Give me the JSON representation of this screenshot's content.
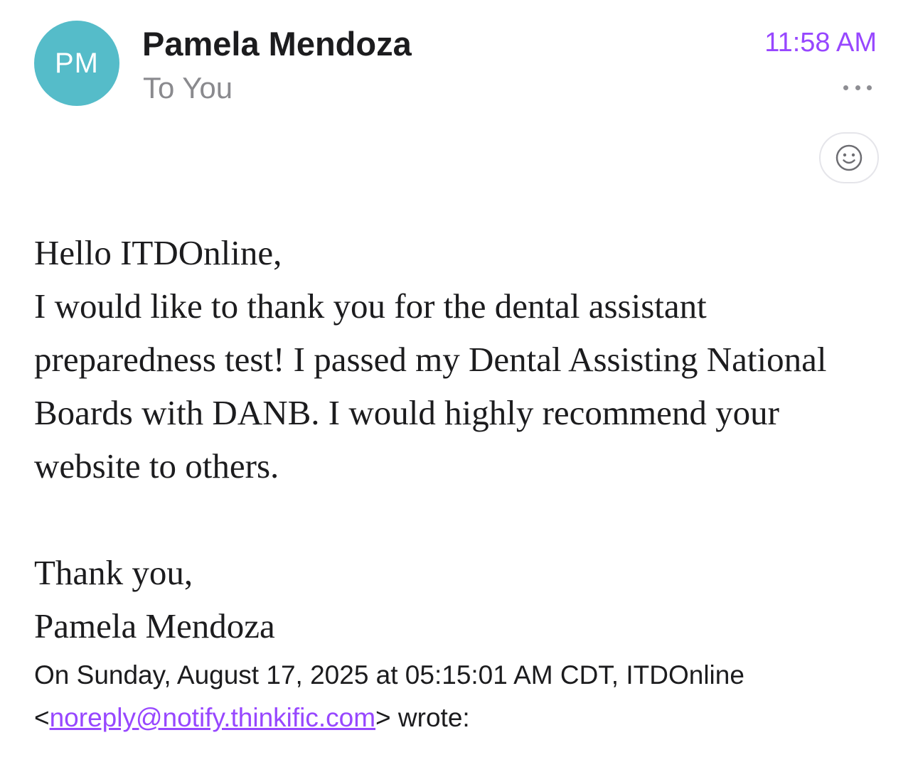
{
  "colors": {
    "accent": "#9747ff",
    "avatar_bg": "#55bcc9"
  },
  "header": {
    "avatar_initials": "PM",
    "sender_name": "Pamela Mendoza",
    "recipient": "To You",
    "time": "11:58 AM",
    "more_icon": "ellipsis-icon",
    "reaction_icon": "smiley-icon"
  },
  "message": {
    "greeting": "Hello ITDOnline,",
    "paragraph": "I would like to thank you for the dental assistant preparedness test! I passed my Dental Assisting National Boards with DANB. I would highly recommend your website to others.",
    "closing": "Thank you,",
    "signature": "Pamela Mendoza"
  },
  "quote": {
    "intro_prefix": "On Sunday, August 17, 2025 at 05:15:01 AM CDT, ITDOnline <",
    "email": "noreply@notify.thinkific.com",
    "intro_suffix": "> wrote:"
  }
}
